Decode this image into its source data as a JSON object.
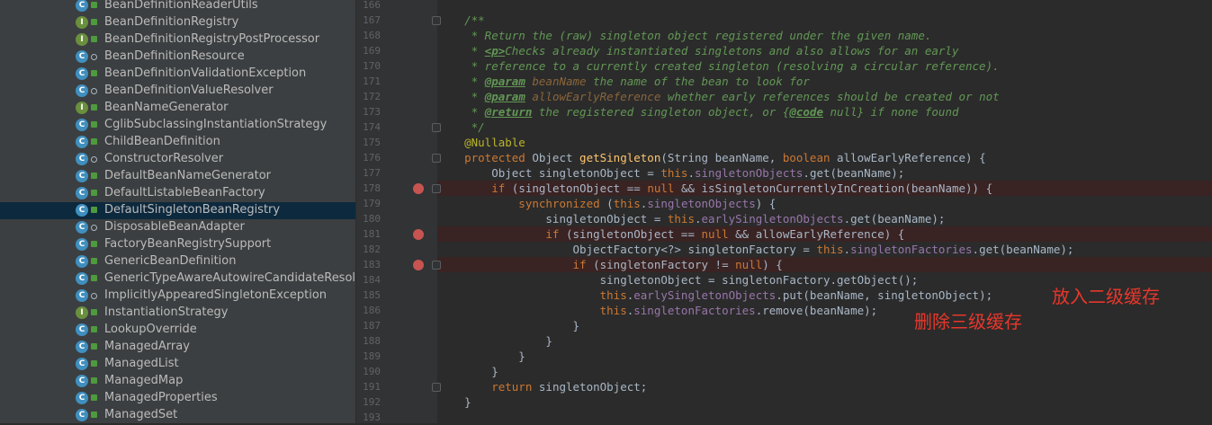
{
  "sidebar": {
    "items": [
      {
        "label": "BeanDefinitionReaderUtils",
        "kind": "class",
        "access": "public"
      },
      {
        "label": "BeanDefinitionRegistry",
        "kind": "interface",
        "access": "public"
      },
      {
        "label": "BeanDefinitionRegistryPostProcessor",
        "kind": "interface",
        "access": "public"
      },
      {
        "label": "BeanDefinitionResource",
        "kind": "class",
        "access": "package"
      },
      {
        "label": "BeanDefinitionValidationException",
        "kind": "class",
        "access": "public"
      },
      {
        "label": "BeanDefinitionValueResolver",
        "kind": "class",
        "access": "package"
      },
      {
        "label": "BeanNameGenerator",
        "kind": "interface",
        "access": "public"
      },
      {
        "label": "CglibSubclassingInstantiationStrategy",
        "kind": "class",
        "access": "public"
      },
      {
        "label": "ChildBeanDefinition",
        "kind": "class",
        "access": "public"
      },
      {
        "label": "ConstructorResolver",
        "kind": "class",
        "access": "package"
      },
      {
        "label": "DefaultBeanNameGenerator",
        "kind": "class",
        "access": "public"
      },
      {
        "label": "DefaultListableBeanFactory",
        "kind": "class",
        "access": "public"
      },
      {
        "label": "DefaultSingletonBeanRegistry",
        "kind": "class",
        "access": "public",
        "selected": true
      },
      {
        "label": "DisposableBeanAdapter",
        "kind": "class",
        "access": "package"
      },
      {
        "label": "FactoryBeanRegistrySupport",
        "kind": "class",
        "access": "public"
      },
      {
        "label": "GenericBeanDefinition",
        "kind": "class",
        "access": "public"
      },
      {
        "label": "GenericTypeAwareAutowireCandidateResolve",
        "kind": "class",
        "access": "public"
      },
      {
        "label": "ImplicitlyAppearedSingletonException",
        "kind": "class",
        "access": "package"
      },
      {
        "label": "InstantiationStrategy",
        "kind": "interface",
        "access": "public"
      },
      {
        "label": "LookupOverride",
        "kind": "class",
        "access": "public"
      },
      {
        "label": "ManagedArray",
        "kind": "class",
        "access": "public"
      },
      {
        "label": "ManagedList",
        "kind": "class",
        "access": "public"
      },
      {
        "label": "ManagedMap",
        "kind": "class",
        "access": "public"
      },
      {
        "label": "ManagedProperties",
        "kind": "class",
        "access": "public"
      },
      {
        "label": "ManagedSet",
        "kind": "class",
        "access": "public"
      }
    ]
  },
  "icon_letters": {
    "class": "C",
    "interface": "I"
  },
  "editor": {
    "lines": [
      {
        "num": "166",
        "segments": []
      },
      {
        "num": "167",
        "segments": [
          {
            "t": "    /**",
            "c": "doc"
          }
        ]
      },
      {
        "num": "168",
        "segments": [
          {
            "t": "     * Return the (raw) singleton object registered under the given name.",
            "c": "doc"
          }
        ]
      },
      {
        "num": "169",
        "segments": [
          {
            "t": "     * ",
            "c": "doc"
          },
          {
            "t": "<p>",
            "c": "doctag"
          },
          {
            "t": "Checks already instantiated singletons and also allows for an early",
            "c": "doc"
          }
        ]
      },
      {
        "num": "170",
        "segments": [
          {
            "t": "     * reference to a currently created singleton (resolving a circular reference).",
            "c": "doc"
          }
        ]
      },
      {
        "num": "171",
        "segments": [
          {
            "t": "     * ",
            "c": "doc"
          },
          {
            "t": "@param",
            "c": "doctag"
          },
          {
            "t": " ",
            "c": "doc"
          },
          {
            "t": "beanName",
            "c": "param"
          },
          {
            "t": " the name of the bean to look for",
            "c": "doc"
          }
        ]
      },
      {
        "num": "172",
        "segments": [
          {
            "t": "     * ",
            "c": "doc"
          },
          {
            "t": "@param",
            "c": "doctag"
          },
          {
            "t": " ",
            "c": "doc"
          },
          {
            "t": "allowEarlyReference",
            "c": "param"
          },
          {
            "t": " whether early references should be created or not",
            "c": "doc"
          }
        ]
      },
      {
        "num": "173",
        "segments": [
          {
            "t": "     * ",
            "c": "doc"
          },
          {
            "t": "@return",
            "c": "doctag"
          },
          {
            "t": " the registered singleton object, or {",
            "c": "doc"
          },
          {
            "t": "@code",
            "c": "doctag"
          },
          {
            "t": " null} if none found",
            "c": "doc"
          }
        ]
      },
      {
        "num": "174",
        "segments": [
          {
            "t": "     */",
            "c": "doc"
          }
        ]
      },
      {
        "num": "175",
        "segments": [
          {
            "t": "    @Nullable",
            "c": "ann"
          }
        ]
      },
      {
        "num": "176",
        "segments": [
          {
            "t": "    protected ",
            "c": "kw"
          },
          {
            "t": "Object ",
            "c": "plain"
          },
          {
            "t": "getSingleton",
            "c": "method"
          },
          {
            "t": "(String beanName, ",
            "c": "plain"
          },
          {
            "t": "boolean ",
            "c": "kw"
          },
          {
            "t": "allowEarlyReference) {",
            "c": "plain"
          }
        ]
      },
      {
        "num": "177",
        "segments": [
          {
            "t": "        Object singletonObject = ",
            "c": "plain"
          },
          {
            "t": "this",
            "c": "kw"
          },
          {
            "t": ".",
            "c": "plain"
          },
          {
            "t": "singletonObjects",
            "c": "field"
          },
          {
            "t": ".get(beanName);",
            "c": "plain"
          }
        ]
      },
      {
        "num": "178",
        "breakpoint": true,
        "segments": [
          {
            "t": "        if ",
            "c": "kw"
          },
          {
            "t": "(singletonObject == ",
            "c": "plain"
          },
          {
            "t": "null ",
            "c": "kw"
          },
          {
            "t": "&& isSingletonCurrentlyInCreation(beanName)) {",
            "c": "plain"
          }
        ]
      },
      {
        "num": "179",
        "segments": [
          {
            "t": "            synchronized ",
            "c": "kw"
          },
          {
            "t": "(",
            "c": "plain"
          },
          {
            "t": "this",
            "c": "kw"
          },
          {
            "t": ".",
            "c": "plain"
          },
          {
            "t": "singletonObjects",
            "c": "field"
          },
          {
            "t": ") {",
            "c": "plain"
          }
        ]
      },
      {
        "num": "180",
        "segments": [
          {
            "t": "                singletonObject = ",
            "c": "plain"
          },
          {
            "t": "this",
            "c": "kw"
          },
          {
            "t": ".",
            "c": "plain"
          },
          {
            "t": "earlySingletonObjects",
            "c": "field"
          },
          {
            "t": ".get(beanName);",
            "c": "plain"
          }
        ]
      },
      {
        "num": "181",
        "breakpoint": true,
        "segments": [
          {
            "t": "                if ",
            "c": "kw"
          },
          {
            "t": "(singletonObject == ",
            "c": "plain"
          },
          {
            "t": "null ",
            "c": "kw"
          },
          {
            "t": "&& allowEarlyReference) {",
            "c": "plain"
          }
        ]
      },
      {
        "num": "182",
        "segments": [
          {
            "t": "                    ObjectFactory<?> singletonFactory = ",
            "c": "plain"
          },
          {
            "t": "this",
            "c": "kw"
          },
          {
            "t": ".",
            "c": "plain"
          },
          {
            "t": "singletonFactories",
            "c": "field"
          },
          {
            "t": ".get(beanName);",
            "c": "plain"
          }
        ]
      },
      {
        "num": "183",
        "breakpoint": true,
        "segments": [
          {
            "t": "                    if ",
            "c": "kw"
          },
          {
            "t": "(singletonFactory != ",
            "c": "plain"
          },
          {
            "t": "null",
            "c": "kw"
          },
          {
            "t": ") {",
            "c": "plain"
          }
        ]
      },
      {
        "num": "184",
        "segments": [
          {
            "t": "                        singletonObject = singletonFactory.getObject();",
            "c": "plain"
          }
        ]
      },
      {
        "num": "185",
        "segments": [
          {
            "t": "                        this",
            "c": "kw"
          },
          {
            "t": ".",
            "c": "plain"
          },
          {
            "t": "earlySingletonObjects",
            "c": "field"
          },
          {
            "t": ".put(beanName, singletonObject);",
            "c": "plain"
          }
        ]
      },
      {
        "num": "186",
        "segments": [
          {
            "t": "                        this",
            "c": "kw"
          },
          {
            "t": ".",
            "c": "plain"
          },
          {
            "t": "singletonFactories",
            "c": "field"
          },
          {
            "t": ".remove(beanName);",
            "c": "plain"
          }
        ]
      },
      {
        "num": "187",
        "segments": [
          {
            "t": "                    }",
            "c": "plain"
          }
        ]
      },
      {
        "num": "188",
        "segments": [
          {
            "t": "                }",
            "c": "plain"
          }
        ]
      },
      {
        "num": "189",
        "segments": [
          {
            "t": "            }",
            "c": "plain"
          }
        ]
      },
      {
        "num": "190",
        "segments": [
          {
            "t": "        }",
            "c": "plain"
          }
        ]
      },
      {
        "num": "191",
        "segments": [
          {
            "t": "        return ",
            "c": "kw"
          },
          {
            "t": "singletonObject;",
            "c": "plain"
          }
        ]
      },
      {
        "num": "192",
        "segments": [
          {
            "t": "    }",
            "c": "plain"
          }
        ]
      },
      {
        "num": "193",
        "segments": []
      }
    ]
  },
  "annotations": {
    "put_second_level": "放入二级缓存",
    "remove_third_level": "删除三级缓存"
  },
  "colors": {
    "annotation_red": "#e8372b",
    "selection": "#0d293e",
    "breakpoint": "#c75450"
  }
}
